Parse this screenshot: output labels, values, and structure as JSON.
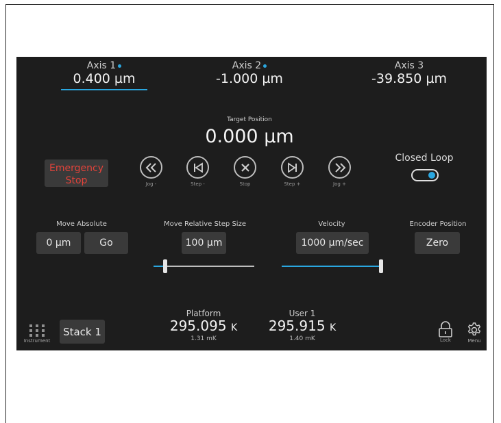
{
  "axes": [
    {
      "label": "Axis 1",
      "value": "0.400 µm"
    },
    {
      "label": "Axis 2",
      "value": "-1.000 µm"
    },
    {
      "label": "Axis 3",
      "value": "-39.850 µm"
    }
  ],
  "target": {
    "label": "Target Position",
    "value": "0.000 µm"
  },
  "emergency_stop": {
    "line1": "Emergency",
    "line2": "Stop"
  },
  "jog_buttons": [
    {
      "label": "Jog -"
    },
    {
      "label": "Step -"
    },
    {
      "label": "Stop"
    },
    {
      "label": "Step +"
    },
    {
      "label": "Jog +"
    }
  ],
  "closed_loop": {
    "label": "Closed Loop",
    "enabled": true
  },
  "move_absolute": {
    "label": "Move Absolute",
    "value": "0 µm",
    "go": "Go"
  },
  "move_relative": {
    "label": "Move Relative Step Size",
    "value": "100 µm",
    "slider_level": 0.1
  },
  "velocity": {
    "label": "Velocity",
    "value": "1000 µm/sec",
    "slider_level": 1.0
  },
  "encoder": {
    "label": "Encoder Position",
    "button": "Zero"
  },
  "footer": {
    "instrument": "Instrument",
    "stack": "Stack 1",
    "platform": {
      "label": "Platform",
      "value": "295.095",
      "unit": "K",
      "sub": "1.31 mK"
    },
    "user1": {
      "label": "User 1",
      "value": "295.915",
      "unit": "K",
      "sub": "1.40 mK"
    },
    "lock": "Lock",
    "menu": "Menu"
  },
  "colors": {
    "accent": "#2aa7e0",
    "estop": "#e2433a",
    "panel": "#1d1d1d",
    "button": "#3a3a3a"
  }
}
